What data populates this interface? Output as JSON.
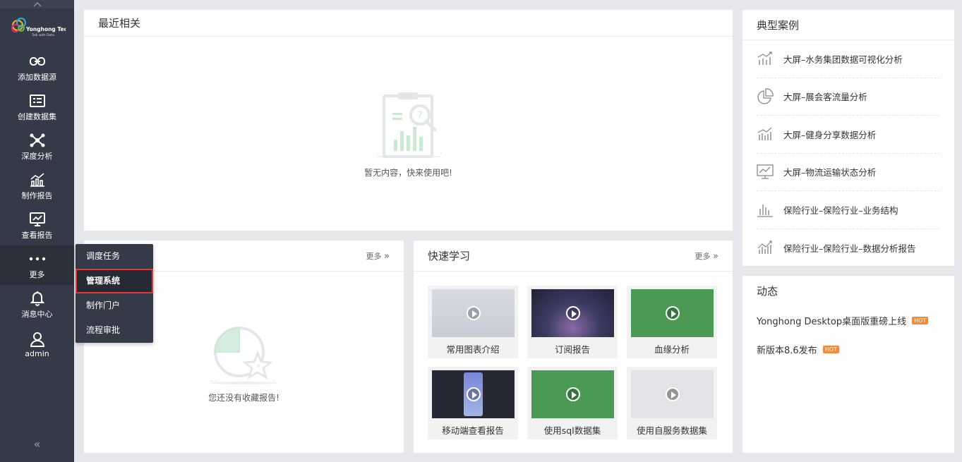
{
  "brand": {
    "name": "Yonghong Tech",
    "tagline": "Talk with Data"
  },
  "sidebar": {
    "items": [
      {
        "label": "添加数据源",
        "icon": "link-icon"
      },
      {
        "label": "创建数据集",
        "icon": "dataset-icon"
      },
      {
        "label": "深度分析",
        "icon": "network-icon"
      },
      {
        "label": "制作报告",
        "icon": "bar-chart-icon"
      },
      {
        "label": "查看报告",
        "icon": "monitor-chart-icon"
      },
      {
        "label": "更多",
        "icon": "more-dots-icon"
      },
      {
        "label": "消息中心",
        "icon": "bell-icon"
      },
      {
        "label": "admin",
        "icon": "user-icon"
      }
    ],
    "collapse": "«"
  },
  "popup_menu": {
    "items": [
      "调度任务",
      "管理系统",
      "制作门户",
      "流程审批"
    ],
    "selected": "管理系统"
  },
  "recent": {
    "title": "最近相关",
    "empty_text": "暂无内容，快来使用吧!"
  },
  "favorites": {
    "more": "更多",
    "empty_text": "您还没有收藏报告!"
  },
  "learning": {
    "title": "快速学习",
    "more": "更多",
    "videos": [
      {
        "label": "常用图表介绍"
      },
      {
        "label": "订阅报告"
      },
      {
        "label": "血缘分析"
      },
      {
        "label": "移动端查看报告"
      },
      {
        "label": "使用sql数据集"
      },
      {
        "label": "使用自服务数据集"
      }
    ]
  },
  "cases": {
    "title": "典型案例",
    "items": [
      {
        "label": "大屏–水务集团数据可视化分析",
        "icon": "trend-bar-icon"
      },
      {
        "label": "大屏–展会客流量分析",
        "icon": "pie-chart-icon"
      },
      {
        "label": "大屏–健身分享数据分析",
        "icon": "trend-bar-icon"
      },
      {
        "label": "大屏–物流运输状态分析",
        "icon": "monitor-chart-icon"
      },
      {
        "label": "保险行业–保险行业–业务结构",
        "icon": "bar-chart-icon"
      },
      {
        "label": "保险行业–保险行业–数据分析报告",
        "icon": "trend-bar-icon"
      }
    ]
  },
  "news": {
    "title": "动态",
    "items": [
      {
        "label": "Yonghong Desktop桌面版重磅上线",
        "badge": "HOT"
      },
      {
        "label": "新版本8.6发布",
        "badge": "HOT"
      }
    ]
  },
  "colors": {
    "sidebar": "#343a47",
    "accent_green": "#4a9a54",
    "hot": "#f08a3c",
    "highlight": "#e53935"
  }
}
